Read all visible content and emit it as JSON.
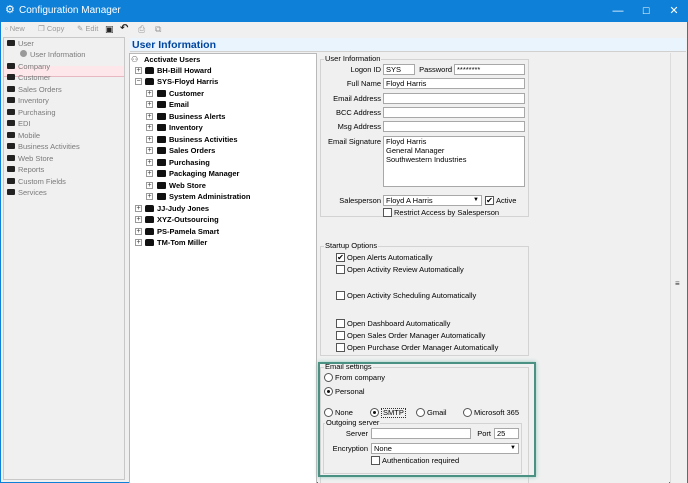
{
  "window": {
    "title": "Configuration Manager",
    "app_icon": "gear-icon",
    "controls": [
      "—",
      "☐",
      "✕"
    ]
  },
  "toolbar": {
    "new_label": "New",
    "copy_label": "Copy",
    "edit_label": "Edit",
    "save_icon": "save-icon",
    "undo_icon": "undo-icon",
    "print_icon": "print-icon",
    "export_icon": "export-icon"
  },
  "nav": {
    "items": [
      "User",
      "User Information",
      "Company",
      "Customer",
      "Sales Orders",
      "Inventory",
      "Purchasing",
      "EDI",
      "Mobile",
      "Business Activities",
      "Web Store",
      "Reports",
      "Custom Fields",
      "Services"
    ]
  },
  "page_title": "User Information",
  "tree": {
    "root": "Acctivate Users",
    "users": [
      {
        "label": "BH-Bill Howard",
        "expander": "+"
      },
      {
        "label": "SYS-Floyd Harris",
        "expander": "−"
      },
      {
        "label": "JJ-Judy Jones",
        "expander": "+"
      },
      {
        "label": "XYZ-Outsourcing",
        "expander": "+"
      },
      {
        "label": "PS-Pamela Smart",
        "expander": "+"
      },
      {
        "label": "TM-Tom Miller",
        "expander": "+"
      }
    ],
    "sys_children": [
      "Customer",
      "Email",
      "Business Alerts",
      "Inventory",
      "Business Activities",
      "Sales Orders",
      "Purchasing",
      "Packaging Manager",
      "Web Store",
      "System Administration"
    ]
  },
  "user_info": {
    "group_title": "User Information",
    "logon_id_label": "Logon ID",
    "logon_id": "SYS",
    "password_label": "Password",
    "password": "********",
    "full_name_label": "Full Name",
    "full_name": "Floyd Harris",
    "email_label": "Email Address",
    "email": "",
    "bcc_label": "BCC Address",
    "bcc": "",
    "msg_label": "Msg Address",
    "msg": "",
    "signature_label": "Email Signature",
    "signature_lines": [
      "Floyd Harris",
      "General Manager",
      "Southwestern Industries"
    ],
    "salesperson_label": "Salesperson",
    "salesperson": "Floyd A Harris",
    "active_label": "Active",
    "active_checked": "✔",
    "restrict_label": "Restrict Access by Salesperson",
    "restrict_checked": ""
  },
  "startup": {
    "group_title": "Startup Options",
    "options": [
      {
        "label": "Open Alerts Automatically",
        "checked": "✔"
      },
      {
        "label": "Open Activity Review Automatically",
        "checked": ""
      },
      {
        "label": "Open Activity Scheduling Automatically",
        "checked": ""
      },
      {
        "label": "Open Dashboard Automatically",
        "checked": ""
      },
      {
        "label": "Open Sales Order Manager Automatically",
        "checked": ""
      },
      {
        "label": "Open Purchase Order Manager Automatically",
        "checked": ""
      }
    ]
  },
  "email_settings": {
    "group_title": "Email settings",
    "from_company": "From company",
    "personal": "Personal",
    "selected": "Personal",
    "protocols": [
      "None",
      "SMTP",
      "Gmail",
      "Microsoft 365"
    ],
    "protocol_selected": "SMTP",
    "outgoing_title": "Outgoing server",
    "server_label": "Server",
    "server": "",
    "port_label": "Port",
    "port": "25",
    "encryption_label": "Encryption",
    "encryption": "None",
    "auth_label": "Authentication required",
    "auth_checked": ""
  },
  "scrollbar_icon": "grip-icon"
}
